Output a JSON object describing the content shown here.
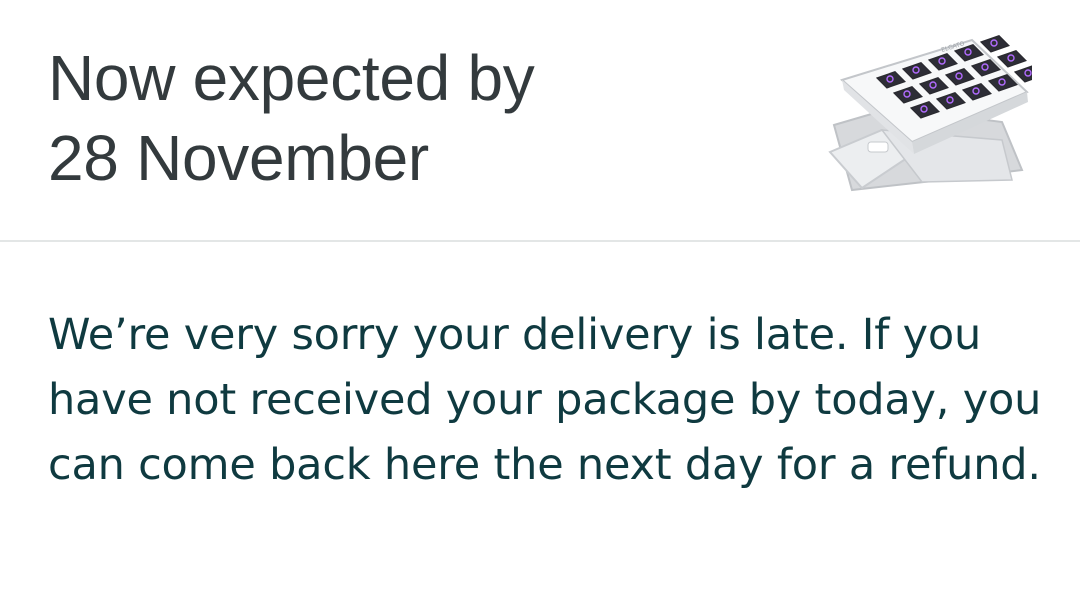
{
  "delivery": {
    "title_line1": "Now expected by",
    "title_line2": "28 November",
    "product_image": "stream-deck-keypad-on-stand",
    "message": "We’re very sorry your delivery is late. If you have not received your package by today, you can come back here the next day for a refund."
  },
  "colors": {
    "title_text": "#333a3d",
    "message_text": "#0f3a40",
    "divider": "#e3e6e6",
    "button_glow": "#b26bff"
  }
}
